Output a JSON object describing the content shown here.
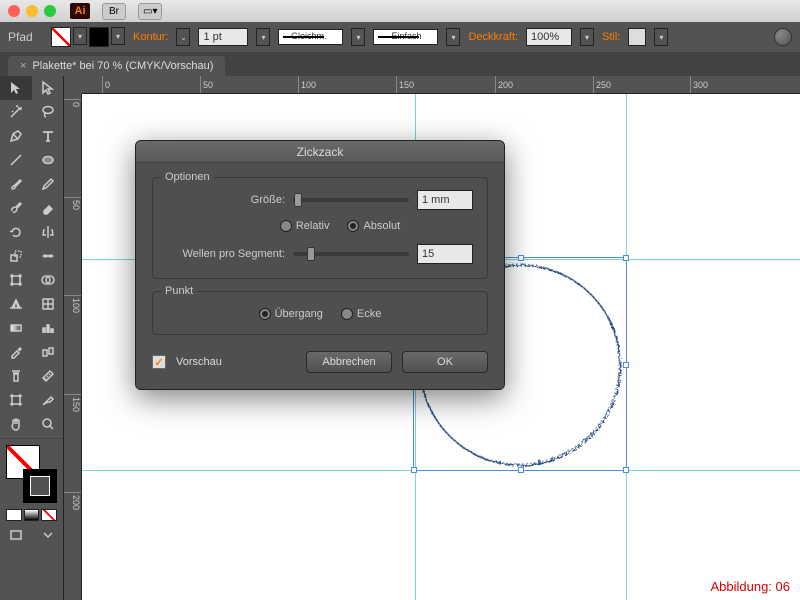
{
  "titlebar": {
    "logo": "Ai",
    "br": "Br"
  },
  "controlbar": {
    "kind": "Pfad",
    "kontur_label": "Kontur:",
    "stroke_width": "1 pt",
    "cap1": "Gleichm.",
    "cap2": "Einfach",
    "opacity_label": "Deckkraft:",
    "opacity_val": "100%",
    "style_label": "Stil:"
  },
  "tab": {
    "label": "Plakette* bei 70 % (CMYK/Vorschau)"
  },
  "ruler": {
    "h": [
      "0",
      "50",
      "100",
      "150",
      "200",
      "250",
      "300"
    ],
    "v": [
      "0",
      "50",
      "100",
      "150",
      "200"
    ]
  },
  "dialog": {
    "title": "Zickzack",
    "options_legend": "Optionen",
    "size_label": "Größe:",
    "size_value": "1 mm",
    "radio_rel": "Relativ",
    "radio_abs": "Absolut",
    "ridges_label": "Wellen pro Segment:",
    "ridges_value": "15",
    "point_legend": "Punkt",
    "point_smooth": "Übergang",
    "point_corner": "Ecke",
    "preview": "Vorschau",
    "cancel": "Abbrechen",
    "ok": "OK"
  },
  "caption": "Abbildung: 06"
}
